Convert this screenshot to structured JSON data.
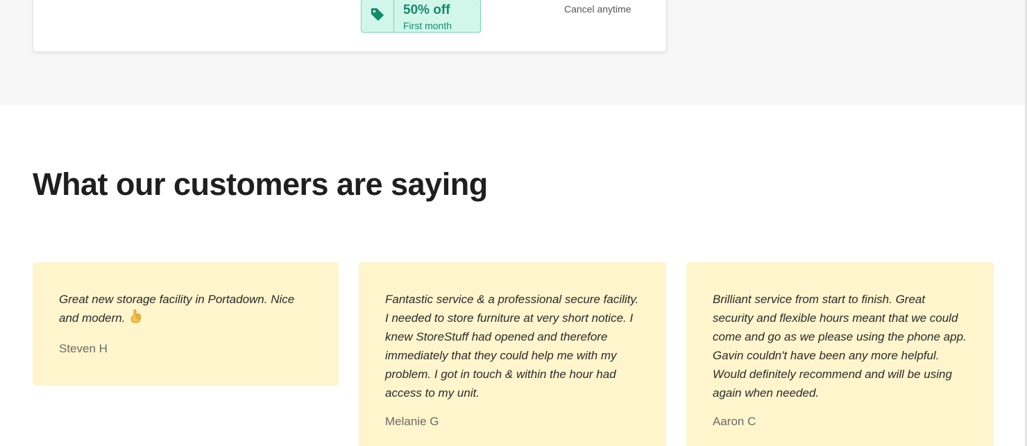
{
  "pricing_card": {
    "offer_title": "50% off",
    "offer_subtitle": "First month",
    "cancel_note": "Cancel anytime"
  },
  "testimonials_section": {
    "title": "What our customers are saying",
    "items": [
      {
        "quote": "Great new storage facility in Portadown. Nice and modern.",
        "emoji": "ok-hand-icon",
        "author": "Steven H"
      },
      {
        "quote": "Fantastic service & a professional secure facility. I needed to store furniture at very short notice. I knew StoreStuff had opened and therefore immediately that they could help me with my problem. I got in touch & within the hour had access to my unit.",
        "author": "Melanie G"
      },
      {
        "quote": "Brilliant service from start to finish. Great security and flexible hours meant that we could come and go as we please using the phone app. Gavin couldn't have been any more helpful. Would definitely recommend and will be using again when needed.",
        "author": "Aaron C"
      }
    ]
  },
  "colors": {
    "offer_green": "#138a6a",
    "offer_bg": "#d2f7ea",
    "testimonial_bg": "#fef5cc"
  }
}
